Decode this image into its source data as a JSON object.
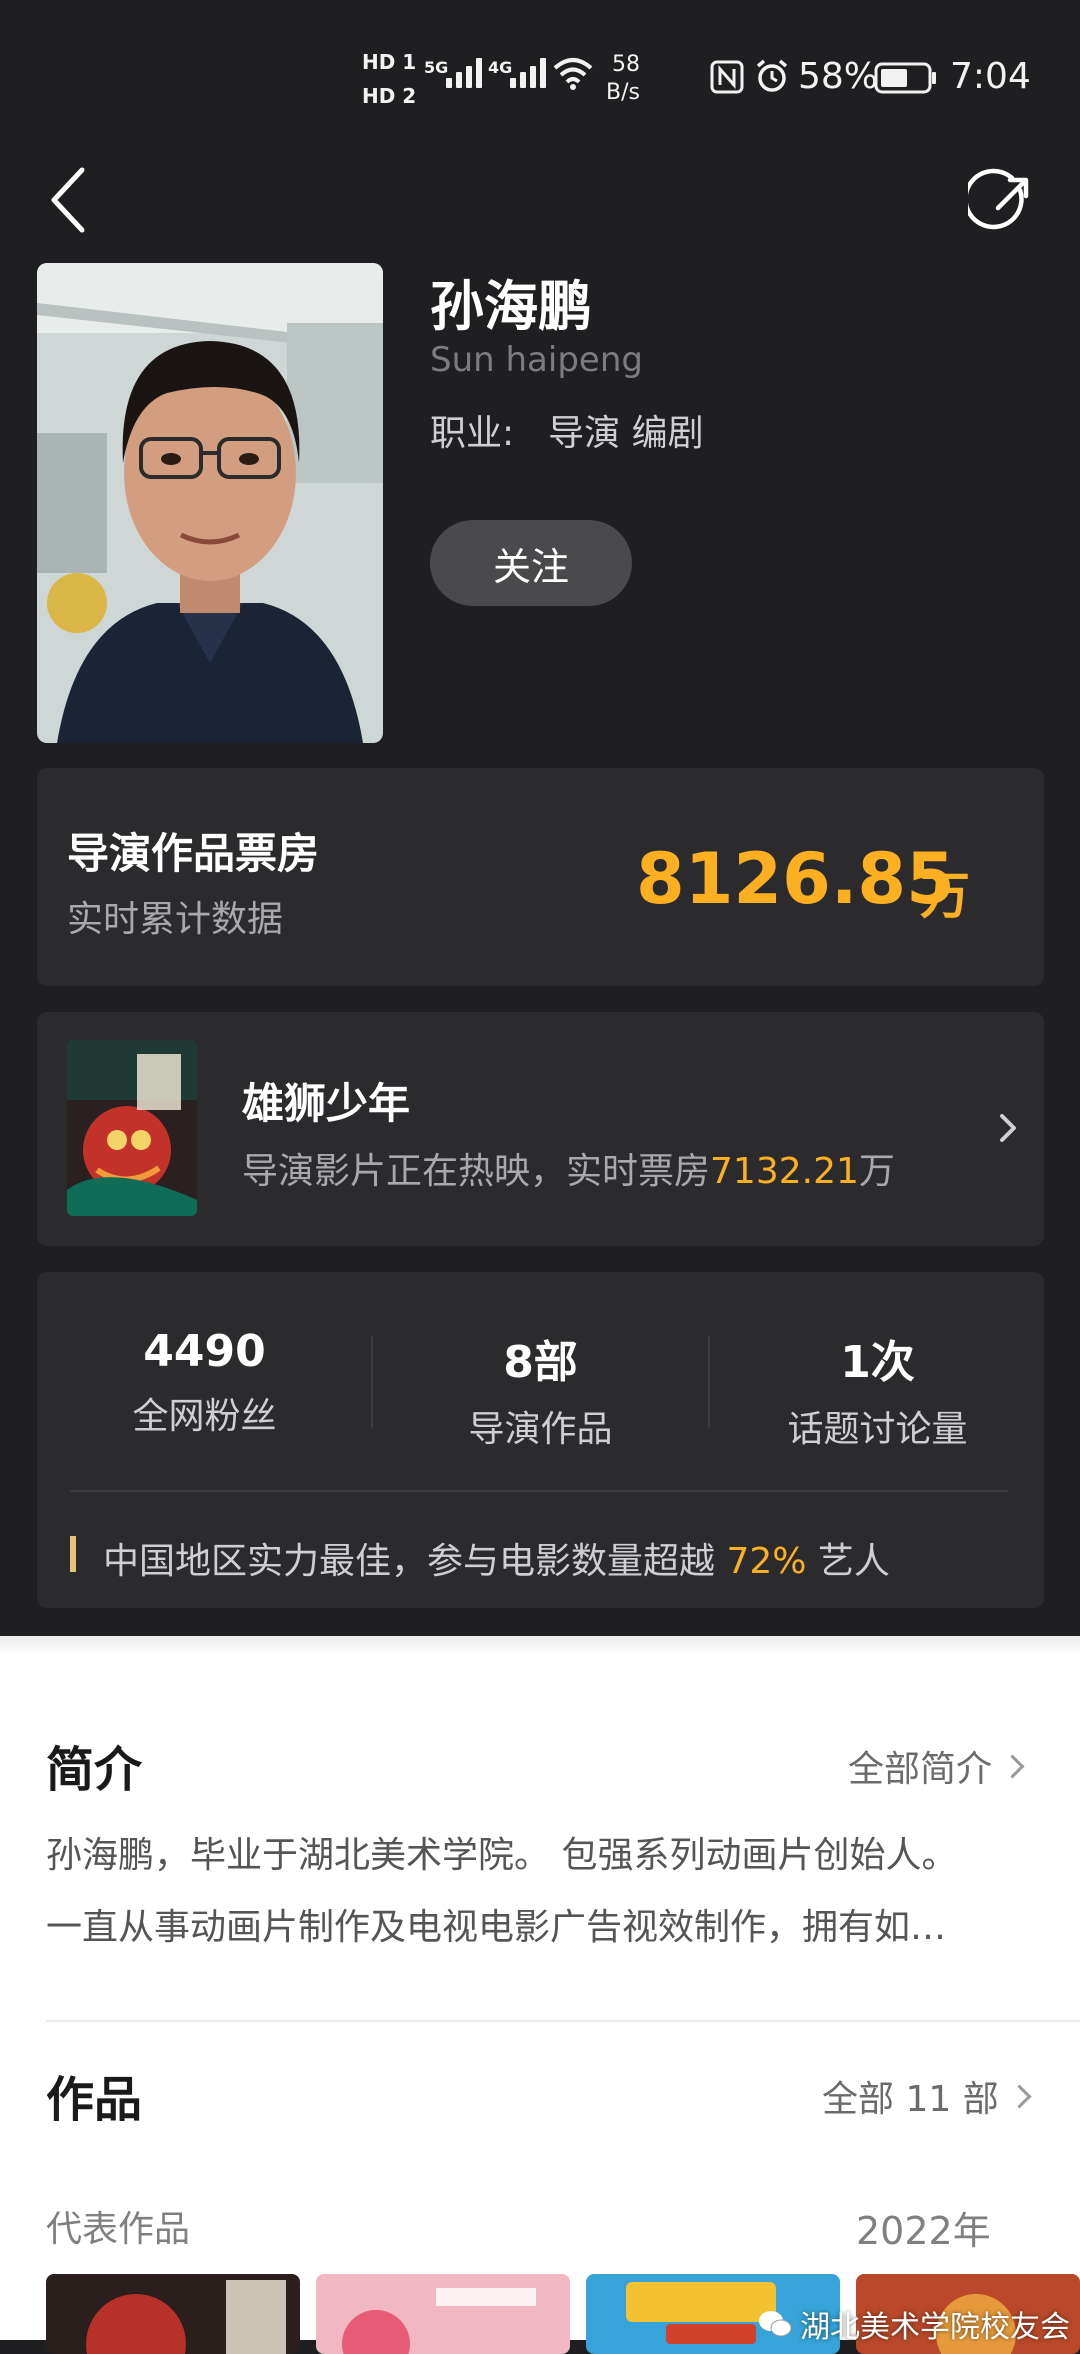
{
  "status_bar": {
    "hd1": "HD 1",
    "hd2": "HD 2",
    "net1": "5G",
    "net2": "4G",
    "speed_value": "58",
    "speed_unit": "B/s",
    "battery": "58%",
    "time": "7:04"
  },
  "header": {
    "back_icon": "chevron-left-icon",
    "share_icon": "share-icon"
  },
  "profile": {
    "name": "孙海鹏",
    "english_name": "Sun haipeng",
    "profession_label": "职业:",
    "profession": "导演 编剧",
    "follow_label": "关注"
  },
  "box_office": {
    "title": "导演作品票房",
    "subtitle": "实时累计数据",
    "value": "8126.85",
    "unit": "万"
  },
  "current_film": {
    "title": "雄狮少年",
    "desc_prefix": "导演影片正在热映，实时票房",
    "desc_value": "7132.21",
    "desc_unit": "万"
  },
  "stats": [
    {
      "value": "4490",
      "label": "全网粉丝"
    },
    {
      "value": "8部",
      "label": "导演作品"
    },
    {
      "value": "1次",
      "label": "话题讨论量"
    }
  ],
  "ranking": {
    "prefix": "中国地区实力最佳，参与电影数量超越 ",
    "percent": "72%",
    "suffix": " 艺人"
  },
  "intro": {
    "title": "简介",
    "link": "全部简介",
    "line1": "孙海鹏，毕业于湖北美术学院。 包强系列动画片创始人。",
    "line2": "一直从事动画片制作及电视电影广告视效制作，拥有如…"
  },
  "works": {
    "title": "作品",
    "link": "全部 11 部",
    "rep_label": "代表作品",
    "year": "2022年"
  },
  "watermark": "湖北美术学院校友会",
  "colors": {
    "accent": "#fcb021",
    "background": "#1f1f22",
    "card": "#2b2b2e"
  }
}
